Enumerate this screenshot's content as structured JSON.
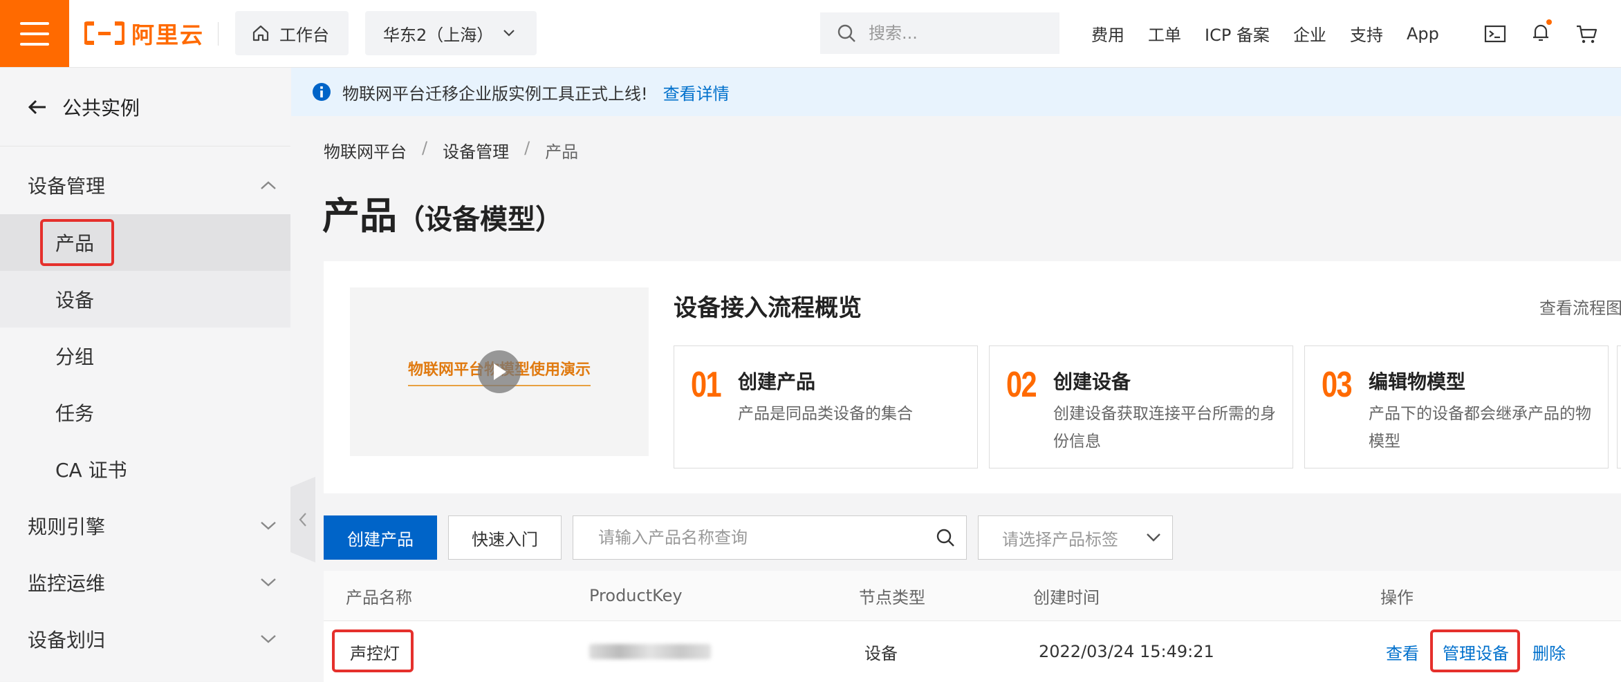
{
  "topbar": {
    "logo_text": "阿里云",
    "home_label": "工作台",
    "region": "华东2（上海）",
    "search_placeholder": "搜索...",
    "nav": [
      "费用",
      "工单",
      "ICP 备案",
      "企业",
      "支持",
      "App"
    ],
    "icons": [
      "terminal-icon",
      "bell-icon",
      "cart-icon"
    ],
    "accent": "#ff6a00"
  },
  "sidebar": {
    "back_label": "公共实例",
    "group_device": "设备管理",
    "items": [
      "产品",
      "设备",
      "分组",
      "任务",
      "CA 证书"
    ],
    "groups": [
      "规则引擎",
      "监控运维",
      "设备划归"
    ]
  },
  "notice": {
    "text": "物联网平台迁移企业版实例工具正式上线!",
    "link": "查看详情"
  },
  "breadcrumb": [
    "物联网平台",
    "设备管理",
    "产品"
  ],
  "page": {
    "title": "产品",
    "subtitle": "（设备模型）"
  },
  "overview": {
    "video_title": "物联网平台物模型使用演示",
    "title": "设备接入流程概览",
    "link": "查看流程图",
    "steps": [
      {
        "num": "01",
        "title": "创建产品",
        "desc": "产品是同品类设备的集合"
      },
      {
        "num": "02",
        "title": "创建设备",
        "desc": "创建设备获取连接平台所需的身份信息"
      },
      {
        "num": "03",
        "title": "编辑物模型",
        "desc": "产品下的设备都会继承产品的物模型"
      }
    ]
  },
  "toolbar": {
    "create": "创建产品",
    "quickstart": "快速入门",
    "query_placeholder": "请输入产品名称查询",
    "tag_placeholder": "请选择产品标签"
  },
  "table": {
    "headers": [
      "产品名称",
      "ProductKey",
      "节点类型",
      "创建时间",
      "操作"
    ],
    "rows": [
      {
        "name": "声控灯",
        "node_type": "设备",
        "created": "2022/03/24 15:49:21",
        "actions": [
          "查看",
          "管理设备",
          "删除"
        ]
      }
    ]
  },
  "colors": {
    "primary": "#0064c8",
    "link": "#0070cc",
    "highlight": "#e5302c"
  }
}
